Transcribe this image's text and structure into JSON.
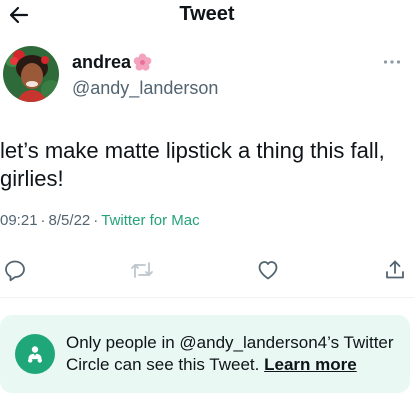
{
  "header": {
    "title": "Tweet",
    "back_icon": "arrow-left-icon"
  },
  "author": {
    "display_name": "andrea",
    "name_emoji_icon": "cherry-blossom-icon",
    "handle": "@andy_landerson",
    "more_icon": "more-dots-icon"
  },
  "tweet": {
    "text": "let’s make matte lipstick a thing this fall, girlies!"
  },
  "meta": {
    "time": "09:21",
    "date": "8/5/22",
    "source": "Twitter for Mac",
    "separator": "·"
  },
  "actions": [
    {
      "icon": "reply-icon"
    },
    {
      "icon": "retweet-icon"
    },
    {
      "icon": "like-icon"
    },
    {
      "icon": "share-icon"
    }
  ],
  "circle_notice": {
    "icon": "twitter-circle-icon",
    "text": "Only people in @andy_landerson4’s Twitter Circle can see this Tweet.",
    "link": "Learn more"
  },
  "colors": {
    "accent": "#1fa679",
    "source_link": "#25a37a",
    "banner_bg": "#e9f8f2",
    "muted": "#536471"
  }
}
